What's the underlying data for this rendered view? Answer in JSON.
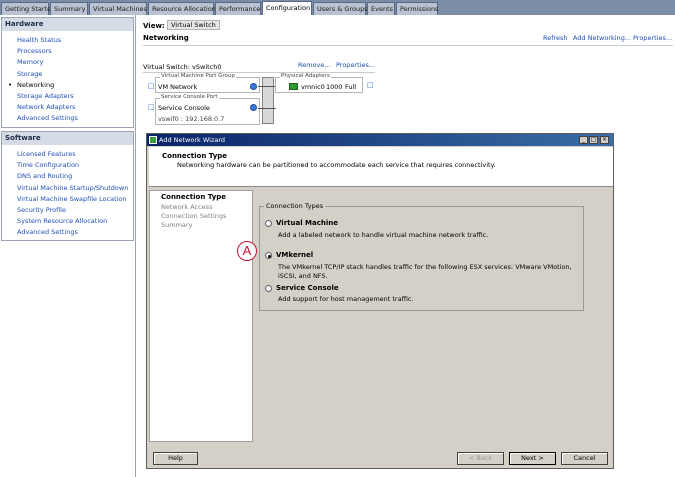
{
  "tabs": [
    {
      "label": "Getting Started"
    },
    {
      "label": "Summary"
    },
    {
      "label": "Virtual Machines"
    },
    {
      "label": "Resource Allocation"
    },
    {
      "label": "Performance"
    },
    {
      "label": "Configuration"
    },
    {
      "label": "Users & Groups"
    },
    {
      "label": "Events"
    },
    {
      "label": "Permissions"
    }
  ],
  "sidebar": {
    "hardware": {
      "title": "Hardware",
      "items": [
        {
          "label": "Health Status"
        },
        {
          "label": "Processors"
        },
        {
          "label": "Memory"
        },
        {
          "label": "Storage"
        },
        {
          "label": "Networking"
        },
        {
          "label": "Storage Adapters"
        },
        {
          "label": "Network Adapters"
        },
        {
          "label": "Advanced Settings"
        }
      ]
    },
    "software": {
      "title": "Software",
      "items": [
        {
          "label": "Licensed Features"
        },
        {
          "label": "Time Configuration"
        },
        {
          "label": "DNS and Routing"
        },
        {
          "label": "Virtual Machine Startup/Shutdown"
        },
        {
          "label": "Virtual Machine Swapfile Location"
        },
        {
          "label": "Security Profile"
        },
        {
          "label": "System Resource Allocation"
        },
        {
          "label": "Advanced Settings"
        }
      ]
    }
  },
  "main": {
    "view_label": "View:",
    "view_value": "Virtual Switch",
    "title": "Networking",
    "links": {
      "refresh": "Refresh",
      "add_networking": "Add Networking...",
      "properties": "Properties..."
    },
    "vswitch": {
      "label": "Virtual Switch: vSwitch0",
      "remove": "Remove...",
      "properties": "Properties...",
      "vm_port_group": {
        "legend": "Virtual Machine Port Group",
        "name": "VM Network"
      },
      "console_port": {
        "legend": "Service Console Port",
        "name": "Service Console",
        "address": "vswif0 : 192.168.0.7"
      },
      "physical_adapters": {
        "legend": "Physical Adapters",
        "nic": "vmnic0",
        "speed": "1000",
        "duplex": "Full"
      }
    }
  },
  "wizard": {
    "title": "Add Network Wizard",
    "header_title": "Connection Type",
    "header_subtitle": "Networking hardware can be partitioned to accommodate each service that requires connectivity.",
    "steps": [
      {
        "label": "Connection Type"
      },
      {
        "label": "Network Access"
      },
      {
        "label": "Connection Settings"
      },
      {
        "label": "Summary"
      }
    ],
    "fieldset_legend": "Connection Types",
    "options": [
      {
        "title": "Virtual Machine",
        "desc": "Add a labeled network to handle virtual machine network traffic."
      },
      {
        "title": "VMkernel",
        "desc": "The VMkernel TCP/IP stack handles traffic for the following ESX services: VMware VMotion, iSCSI, and NFS."
      },
      {
        "title": "Service Console",
        "desc": "Add support for host management traffic."
      }
    ],
    "selected_option": "VMkernel",
    "callout": "A",
    "buttons": {
      "help": "Help",
      "back": "< Back",
      "next": "Next >",
      "cancel": "Cancel"
    }
  },
  "colors": {
    "tabbar": "#7b8ca6",
    "link": "#1f4fb5",
    "titlebar": "#0a246a",
    "callout": "#c8102e"
  }
}
